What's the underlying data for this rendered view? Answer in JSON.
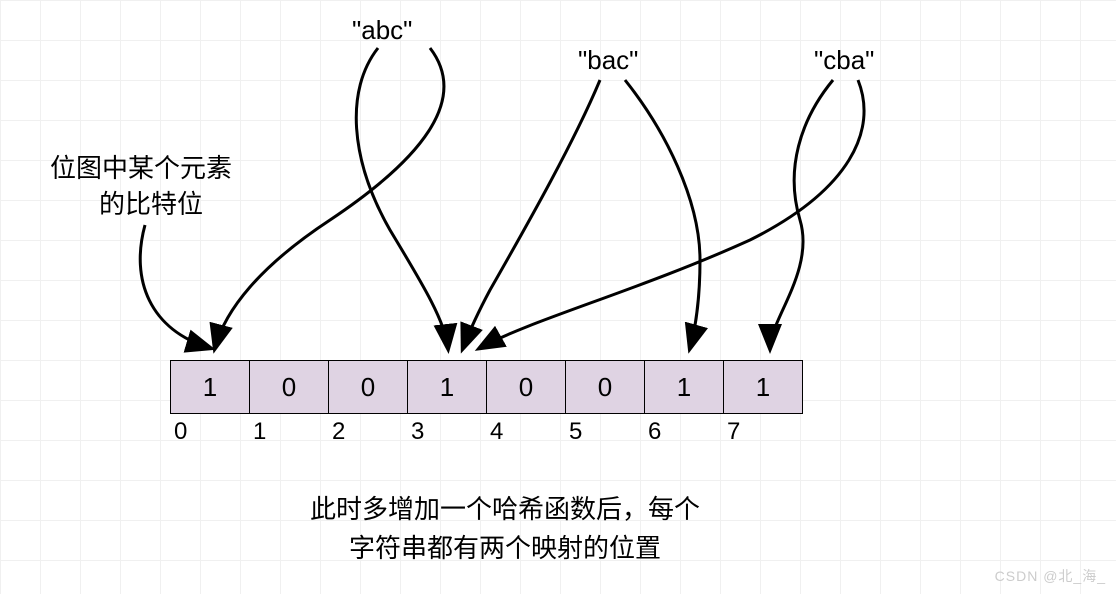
{
  "strings": {
    "abc": "\"abc\"",
    "bac": "\"bac\"",
    "cba": "\"cba\""
  },
  "description": {
    "line1": "位图中某个元素",
    "line2": "的比特位"
  },
  "bits": [
    "1",
    "0",
    "0",
    "1",
    "0",
    "0",
    "1",
    "1"
  ],
  "indices": [
    "0",
    "1",
    "2",
    "3",
    "4",
    "5",
    "6",
    "7"
  ],
  "bottom": {
    "line1": "此时多增加一个哈希函数后，每个",
    "line2": "字符串都有两个映射的位置"
  },
  "watermark": "CSDN @北_海_",
  "chart_data": {
    "type": "diagram",
    "title": "Bloom filter / hash mapping illustration",
    "bit_array": [
      1,
      0,
      0,
      1,
      0,
      0,
      1,
      1
    ],
    "indices": [
      0,
      1,
      2,
      3,
      4,
      5,
      6,
      7
    ],
    "mappings": [
      {
        "input": "abc",
        "positions": [
          0,
          3
        ]
      },
      {
        "input": "bac",
        "positions": [
          3,
          6
        ]
      },
      {
        "input": "cba",
        "positions": [
          3,
          7
        ]
      }
    ],
    "annotation_left": "位图中某个元素的比特位",
    "annotation_bottom": "此时多增加一个哈希函数后，每个字符串都有两个映射的位置"
  }
}
